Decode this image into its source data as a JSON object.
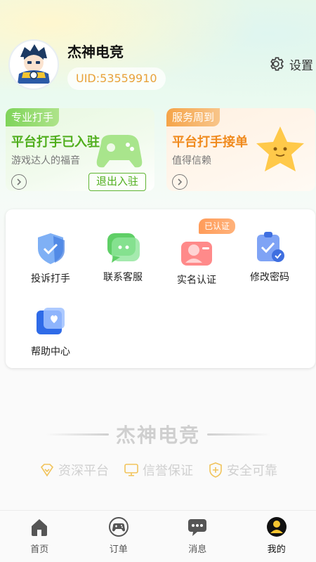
{
  "profile": {
    "username": "杰神电竞",
    "uid": "UID:53559910"
  },
  "header": {
    "settings_label": "设置"
  },
  "promos": [
    {
      "tag": "专业打手",
      "title": "平台打手已入驻",
      "subtitle": "游戏达人的福音",
      "action_label": "退出入驻"
    },
    {
      "tag": "服务周到",
      "title": "平台打手接单",
      "subtitle": "值得信赖"
    }
  ],
  "services": {
    "items": [
      {
        "label": "投诉打手",
        "icon": "shield-check-icon"
      },
      {
        "label": "联系客服",
        "icon": "chat-bubble-icon"
      },
      {
        "label": "实名认证",
        "icon": "id-card-icon",
        "badge": "已认证"
      },
      {
        "label": "修改密码",
        "icon": "clipboard-check-icon"
      },
      {
        "label": "帮助中心",
        "icon": "heart-card-icon"
      }
    ]
  },
  "brand": {
    "name": "杰神电竞",
    "features": [
      "资深平台",
      "信誉保证",
      "安全可靠"
    ]
  },
  "tabbar": {
    "items": [
      {
        "label": "首页",
        "icon": "home-icon"
      },
      {
        "label": "订单",
        "icon": "gamepad-icon"
      },
      {
        "label": "消息",
        "icon": "message-icon"
      },
      {
        "label": "我的",
        "icon": "user-icon",
        "active": true
      }
    ]
  },
  "colors": {
    "accent_green": "#4fae1c",
    "accent_orange": "#f08a1d",
    "uid_text": "#e8a23a",
    "badge": "#ff9c5a"
  }
}
